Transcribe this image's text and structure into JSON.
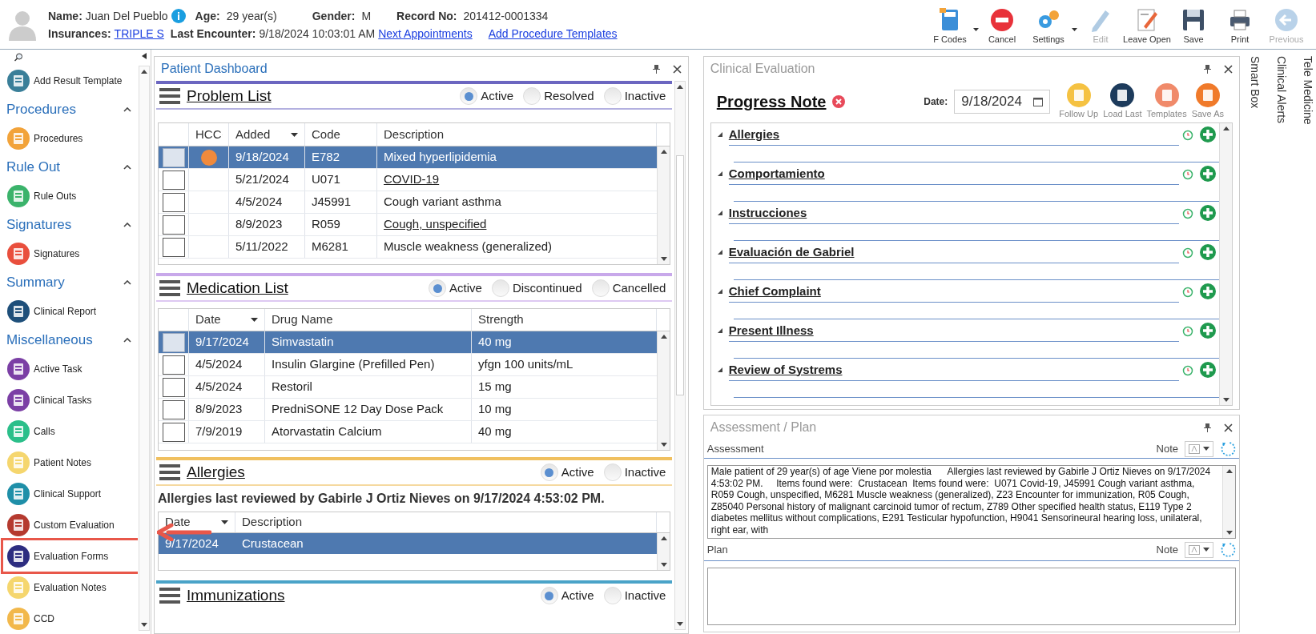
{
  "patient": {
    "name_label": "Name:",
    "name": "Juan Del Pueblo",
    "age_label": "Age:",
    "age": "29 year(s)",
    "gender_label": "Gender:",
    "gender": "M",
    "record_label": "Record No:",
    "record": "201412-0001334",
    "insurance_label": "Insurances:",
    "insurance": "TRIPLE S",
    "encounter_label": "Last Encounter:",
    "encounter": "9/18/2024 10:03:01 AM",
    "links": [
      "Next Appointments",
      "Add Procedure Templates"
    ]
  },
  "toolbar": [
    {
      "label": "F Codes",
      "disabled": false,
      "dropdown": true
    },
    {
      "label": "Cancel",
      "disabled": false,
      "dropdown": false
    },
    {
      "label": "Settings",
      "disabled": false,
      "dropdown": true
    },
    {
      "label": "Edit",
      "disabled": true,
      "dropdown": false
    },
    {
      "label": "Leave Open",
      "disabled": false,
      "dropdown": false
    },
    {
      "label": "Save",
      "disabled": false,
      "dropdown": false
    },
    {
      "label": "Print",
      "disabled": false,
      "dropdown": false
    },
    {
      "label": "Previous",
      "disabled": true,
      "dropdown": false
    }
  ],
  "sidebar": {
    "items": [
      {
        "kind": "item",
        "label": "Add Result Template",
        "annotated": false
      },
      {
        "kind": "group",
        "label": "Procedures",
        "expanded": true
      },
      {
        "kind": "item",
        "label": "Procedures",
        "annotated": false
      },
      {
        "kind": "group",
        "label": "Rule Out",
        "expanded": true
      },
      {
        "kind": "item",
        "label": "Rule Outs",
        "annotated": false
      },
      {
        "kind": "group",
        "label": "Signatures",
        "expanded": true
      },
      {
        "kind": "item",
        "label": "Signatures",
        "annotated": false
      },
      {
        "kind": "group",
        "label": "Summary",
        "expanded": true
      },
      {
        "kind": "item",
        "label": "Clinical Report",
        "annotated": false
      },
      {
        "kind": "group",
        "label": "Miscellaneous",
        "expanded": true
      },
      {
        "kind": "item",
        "label": "Active Task",
        "annotated": false
      },
      {
        "kind": "item",
        "label": "Clinical Tasks",
        "annotated": false
      },
      {
        "kind": "item",
        "label": "Calls",
        "annotated": false
      },
      {
        "kind": "item",
        "label": "Patient Notes",
        "annotated": false
      },
      {
        "kind": "item",
        "label": "Clinical Support",
        "annotated": false
      },
      {
        "kind": "item",
        "label": "Custom Evaluation",
        "annotated": false
      },
      {
        "kind": "item",
        "label": "Evaluation Forms",
        "annotated": true
      },
      {
        "kind": "item",
        "label": "Evaluation Notes",
        "annotated": false
      },
      {
        "kind": "item",
        "label": "CCD",
        "annotated": false
      }
    ]
  },
  "dashboard": {
    "title": "Patient Dashboard",
    "problem_list": {
      "title": "Problem List",
      "filters": [
        {
          "label": "Active",
          "selected": true
        },
        {
          "label": "Resolved",
          "selected": false
        },
        {
          "label": "Inactive",
          "selected": false
        }
      ],
      "columns": [
        "HCC",
        "Added",
        "Code",
        "Description"
      ],
      "rows": [
        {
          "selected": true,
          "hcc": true,
          "added": "9/18/2024",
          "code": "E782",
          "description": "Mixed hyperlipidemia",
          "underlined": false
        },
        {
          "selected": false,
          "hcc": false,
          "added": "5/21/2024",
          "code": "U071",
          "description": "COVID-19",
          "underlined": true
        },
        {
          "selected": false,
          "hcc": false,
          "added": "4/5/2024",
          "code": "J45991",
          "description": "Cough variant asthma",
          "underlined": false
        },
        {
          "selected": false,
          "hcc": false,
          "added": "8/9/2023",
          "code": "R059",
          "description": "Cough, unspecified",
          "underlined": true
        },
        {
          "selected": false,
          "hcc": false,
          "added": "5/11/2022",
          "code": "M6281",
          "description": "Muscle weakness (generalized)",
          "underlined": false
        }
      ]
    },
    "medication_list": {
      "title": "Medication List",
      "filters": [
        {
          "label": "Active",
          "selected": true
        },
        {
          "label": "Discontinued",
          "selected": false
        },
        {
          "label": "Cancelled",
          "selected": false
        }
      ],
      "columns": [
        "Date",
        "Drug Name",
        "Strength"
      ],
      "rows": [
        {
          "selected": true,
          "date": "9/17/2024",
          "drug": "Simvastatin",
          "strength": "40 mg"
        },
        {
          "selected": false,
          "date": "4/5/2024",
          "drug": "Insulin Glargine (Prefilled Pen)",
          "strength": "yfgn 100 units/mL"
        },
        {
          "selected": false,
          "date": "4/5/2024",
          "drug": "Restoril",
          "strength": "15 mg"
        },
        {
          "selected": false,
          "date": "8/9/2023",
          "drug": "PredniSONE 12 Day Dose Pack",
          "strength": "10 mg"
        },
        {
          "selected": false,
          "date": "7/9/2019",
          "drug": "Atorvastatin Calcium",
          "strength": "40 mg"
        }
      ]
    },
    "allergies": {
      "title": "Allergies",
      "filters": [
        {
          "label": "Active",
          "selected": true
        },
        {
          "label": "Inactive",
          "selected": false
        }
      ],
      "review": "Allergies last reviewed by Gabirle J Ortiz Nieves on 9/17/2024 4:53:02 PM.",
      "columns": [
        "Date",
        "Description"
      ],
      "rows": [
        {
          "selected": true,
          "date": "9/17/2024",
          "description": "Crustacean"
        }
      ]
    },
    "immunizations": {
      "title": "Immunizations",
      "filters": [
        {
          "label": "Active",
          "selected": true
        },
        {
          "label": "Inactive",
          "selected": false
        }
      ]
    }
  },
  "clinical_evaluation": {
    "title": "Clinical Evaluation",
    "note_title": "Progress Note",
    "date_label": "Date:",
    "date": "9/18/2024",
    "actions": [
      "Follow Up",
      "Load Last",
      "Templates",
      "Save As"
    ],
    "sections": [
      {
        "title": "Allergies",
        "expanded": true
      },
      {
        "title": "Comportamiento",
        "expanded": true
      },
      {
        "title": "Instrucciones",
        "expanded": true
      },
      {
        "title": "Evaluación de Gabriel",
        "expanded": true
      },
      {
        "title": "Chief Complaint",
        "expanded": true
      },
      {
        "title": "Present Illness",
        "expanded": true
      },
      {
        "title": "Review of Systrems",
        "expanded": true
      }
    ]
  },
  "assessment_plan": {
    "title": "Assessment / Plan",
    "assessment_label": "Assessment",
    "note_label": "Note",
    "assessment_text": "Male patient of 29 year(s) of age Viene por molestia      Allergies last reviewed by Gabirle J Ortiz Nieves on 9/17/2024 4:53:02 PM.     Items found were:  Crustacean  Items found were:  U071 Covid-19, J45991 Cough variant asthma, R059 Cough, unspecified, M6281 Muscle weakness (generalized), Z23 Encounter for immunization, R05 Cough, Z85040 Personal history of malignant carcinoid tumor of rectum, Z789 Other specified health status, E119 Type 2 diabetes mellitus without complications, E291 Testicular hypofunction, H9041 Sensorineural hearing loss, unilateral, right ear, with",
    "plan_label": "Plan",
    "plan_note_label": "Note"
  },
  "side_tabs": [
    "Smart Box",
    "Clinical Alerts",
    "Tele Medicine"
  ]
}
